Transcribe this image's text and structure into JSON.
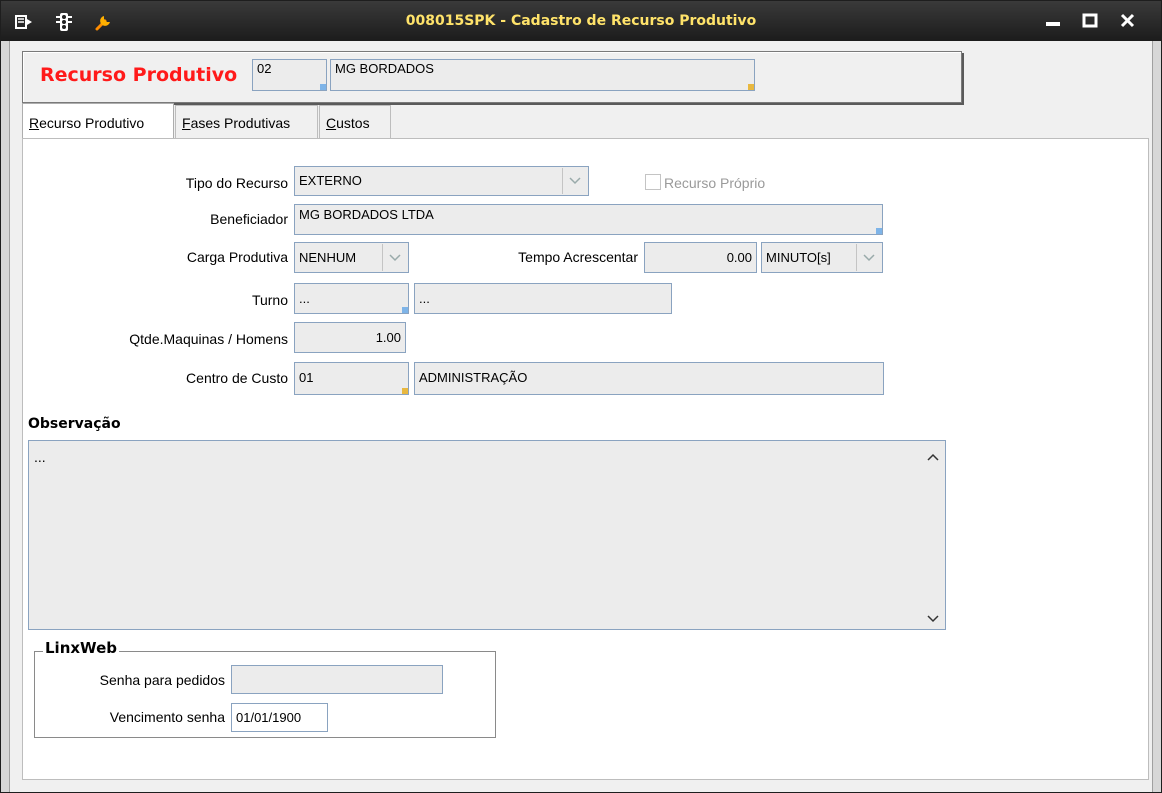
{
  "window": {
    "title": "008015SPK - Cadastro de Recurso Produtivo",
    "title_color": "#ffe36a",
    "icons": [
      "menu-icon",
      "traffic-light-icon",
      "wrench-icon"
    ],
    "controls": [
      "minimize-icon",
      "maximize-icon",
      "close-icon"
    ]
  },
  "header": {
    "label": "Recurso Produtivo",
    "label_color": "#ff1a1a",
    "code": "02",
    "name": "MG BORDADOS"
  },
  "tabs": [
    {
      "label": "Recurso Produtivo",
      "accelerator": "R",
      "active": true
    },
    {
      "label": "Fases Produtivas",
      "accelerator": "F",
      "active": false
    },
    {
      "label": "Custos",
      "accelerator": "C",
      "active": false
    }
  ],
  "form": {
    "tipo_recurso": {
      "label": "Tipo do Recurso",
      "value": "EXTERNO"
    },
    "recurso_proprio": {
      "label": "Recurso Próprio",
      "checked": false
    },
    "beneficiador": {
      "label": "Beneficiador",
      "value": "MG BORDADOS LTDA"
    },
    "carga_produtiva": {
      "label": "Carga Produtiva",
      "value": "NENHUM"
    },
    "tempo_acrescentar": {
      "label": "Tempo Acrescentar",
      "value": "0.00",
      "unit": "MINUTO[s]"
    },
    "turno": {
      "label": "Turno",
      "code": "...",
      "desc": "..."
    },
    "qtde": {
      "label": "Qtde.Maquinas / Homens",
      "value": "1.00"
    },
    "centro_custo": {
      "label": "Centro de Custo",
      "code": "01",
      "desc": "ADMINISTRAÇÃO"
    }
  },
  "observacao": {
    "title": "Observação",
    "value": "..."
  },
  "linxweb": {
    "title": "LinxWeb",
    "senha": {
      "label": "Senha para pedidos",
      "value": ""
    },
    "vencimento": {
      "label": "Vencimento senha",
      "value": "01/01/1900"
    }
  }
}
